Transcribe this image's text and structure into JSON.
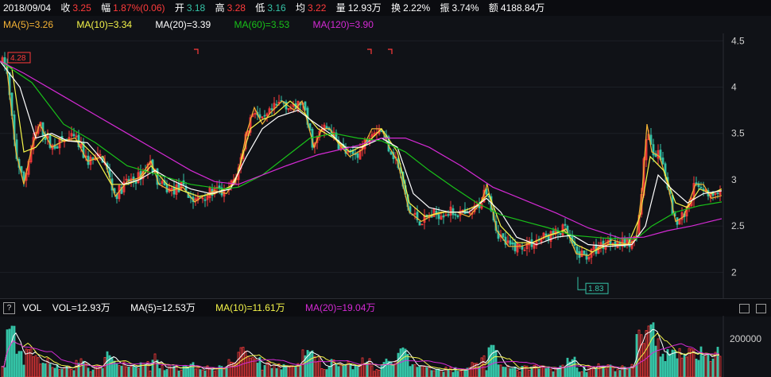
{
  "header": {
    "date": "2018/09/04",
    "close_label": "收",
    "close_value": "3.25",
    "change_label": "幅",
    "change_value": "1.87%(0.06)",
    "open_label": "开",
    "open_value": "3.18",
    "high_label": "高",
    "high_value": "3.28",
    "low_label": "低",
    "low_value": "3.16",
    "avg_label": "均",
    "avg_value": "3.22",
    "volume_label": "量",
    "volume_value": "12.93万",
    "turnover_label": "换",
    "turnover_value": "2.22%",
    "amplitude_label": "振",
    "amplitude_value": "3.74%",
    "amount_label": "额",
    "amount_value": "4188.84万"
  },
  "ma_legend": [
    {
      "text": "MA(5)=3.26",
      "color": "#f5b335"
    },
    {
      "text": "MA(10)=3.34",
      "color": "#f5f54a"
    },
    {
      "text": "MA(20)=3.39",
      "color": "#ffffff"
    },
    {
      "text": "MA(60)=3.53",
      "color": "#19c119"
    },
    {
      "text": "MA(120)=3.90",
      "color": "#d52ad5"
    }
  ],
  "volume_header": {
    "help_icon": "question-icon",
    "title": "VOL",
    "vol": "VOL=12.93万",
    "ma5": "MA(5)=12.53万",
    "ma10": "MA(10)=11.61万",
    "ma20": "MA(20)=19.04万"
  },
  "colors": {
    "up": "#ff3b3b",
    "down": "#35c3a7",
    "ma5": "#f5b335",
    "ma10": "#f5f54a",
    "ma20": "#ffffff",
    "ma60": "#19c119",
    "ma120": "#d52ad5",
    "background": "#101217"
  },
  "chart_data": {
    "type": "line",
    "description": "Daily candlestick chart with moving averages and volume sub-chart",
    "y_ticks": [
      "4.5",
      "4",
      "3.5",
      "3",
      "2.5",
      "2"
    ],
    "ylim": [
      1.72,
      4.58
    ],
    "high_marker": "4.28",
    "low_marker": "1.83",
    "volume_tick": "200000",
    "volume_ylim": [
      0,
      320000
    ],
    "series": [
      {
        "name": "MA(5)",
        "color": "#f5b335",
        "points": [
          [
            0,
            4.28
          ],
          [
            8,
            4.25
          ],
          [
            20,
            3.3
          ],
          [
            30,
            2.95
          ],
          [
            40,
            3.35
          ],
          [
            50,
            3.6
          ],
          [
            65,
            3.35
          ],
          [
            80,
            3.42
          ],
          [
            95,
            3.45
          ],
          [
            110,
            3.2
          ],
          [
            130,
            3.25
          ],
          [
            145,
            2.82
          ],
          [
            160,
            2.98
          ],
          [
            175,
            3.02
          ],
          [
            190,
            3.2
          ],
          [
            200,
            2.95
          ],
          [
            215,
            2.88
          ],
          [
            230,
            2.92
          ],
          [
            245,
            2.76
          ],
          [
            255,
            2.82
          ],
          [
            270,
            2.88
          ],
          [
            285,
            2.85
          ],
          [
            300,
            3.08
          ],
          [
            310,
            3.5
          ],
          [
            320,
            3.78
          ],
          [
            330,
            3.6
          ],
          [
            340,
            3.72
          ],
          [
            355,
            3.85
          ],
          [
            370,
            3.75
          ],
          [
            380,
            3.85
          ],
          [
            395,
            3.35
          ],
          [
            405,
            3.55
          ],
          [
            415,
            3.55
          ],
          [
            425,
            3.4
          ],
          [
            440,
            3.25
          ],
          [
            455,
            3.32
          ],
          [
            468,
            3.55
          ],
          [
            480,
            3.55
          ],
          [
            490,
            3.35
          ],
          [
            500,
            3.2
          ],
          [
            515,
            2.65
          ],
          [
            530,
            2.55
          ],
          [
            545,
            2.62
          ],
          [
            560,
            2.65
          ],
          [
            575,
            2.65
          ],
          [
            590,
            2.6
          ],
          [
            605,
            2.75
          ],
          [
            613,
            2.95
          ],
          [
            625,
            2.45
          ],
          [
            640,
            2.28
          ],
          [
            655,
            2.28
          ],
          [
            670,
            2.32
          ],
          [
            685,
            2.38
          ],
          [
            700,
            2.42
          ],
          [
            712,
            2.47
          ],
          [
            725,
            2.2
          ],
          [
            740,
            2.18
          ],
          [
            755,
            2.28
          ],
          [
            770,
            2.35
          ],
          [
            790,
            2.3
          ],
          [
            800,
            2.35
          ],
          [
            808,
            2.9
          ],
          [
            814,
            3.6
          ],
          [
            820,
            3.3
          ],
          [
            830,
            3.25
          ],
          [
            840,
            2.95
          ],
          [
            850,
            2.55
          ],
          [
            860,
            2.6
          ],
          [
            875,
            2.95
          ],
          [
            885,
            2.95
          ],
          [
            895,
            2.8
          ],
          [
            908,
            2.83
          ]
        ]
      },
      {
        "name": "MA(10)",
        "color": "#f5f54a",
        "points": [
          [
            0,
            4.28
          ],
          [
            15,
            4.2
          ],
          [
            30,
            3.3
          ],
          [
            45,
            3.35
          ],
          [
            60,
            3.5
          ],
          [
            80,
            3.42
          ],
          [
            100,
            3.42
          ],
          [
            120,
            3.25
          ],
          [
            140,
            2.95
          ],
          [
            160,
            2.95
          ],
          [
            175,
            3.0
          ],
          [
            190,
            3.15
          ],
          [
            210,
            2.95
          ],
          [
            230,
            2.88
          ],
          [
            250,
            2.82
          ],
          [
            270,
            2.85
          ],
          [
            295,
            2.95
          ],
          [
            315,
            3.55
          ],
          [
            330,
            3.65
          ],
          [
            345,
            3.7
          ],
          [
            365,
            3.85
          ],
          [
            385,
            3.7
          ],
          [
            400,
            3.55
          ],
          [
            420,
            3.45
          ],
          [
            440,
            3.3
          ],
          [
            460,
            3.38
          ],
          [
            480,
            3.55
          ],
          [
            500,
            3.3
          ],
          [
            515,
            2.75
          ],
          [
            535,
            2.6
          ],
          [
            555,
            2.65
          ],
          [
            580,
            2.65
          ],
          [
            600,
            2.72
          ],
          [
            615,
            2.85
          ],
          [
            630,
            2.5
          ],
          [
            650,
            2.32
          ],
          [
            670,
            2.32
          ],
          [
            690,
            2.4
          ],
          [
            710,
            2.45
          ],
          [
            725,
            2.3
          ],
          [
            745,
            2.22
          ],
          [
            765,
            2.3
          ],
          [
            790,
            2.3
          ],
          [
            805,
            2.6
          ],
          [
            818,
            3.25
          ],
          [
            835,
            3.1
          ],
          [
            850,
            2.75
          ],
          [
            865,
            2.7
          ],
          [
            880,
            2.9
          ],
          [
            895,
            2.85
          ],
          [
            908,
            2.9
          ]
        ]
      },
      {
        "name": "MA(20)",
        "color": "#ffffff",
        "points": [
          [
            0,
            4.28
          ],
          [
            25,
            4.0
          ],
          [
            45,
            3.45
          ],
          [
            65,
            3.5
          ],
          [
            85,
            3.42
          ],
          [
            110,
            3.4
          ],
          [
            135,
            3.15
          ],
          [
            155,
            2.95
          ],
          [
            175,
            3.0
          ],
          [
            195,
            3.1
          ],
          [
            215,
            3.0
          ],
          [
            240,
            2.9
          ],
          [
            265,
            2.85
          ],
          [
            290,
            2.9
          ],
          [
            310,
            3.25
          ],
          [
            330,
            3.55
          ],
          [
            350,
            3.68
          ],
          [
            375,
            3.75
          ],
          [
            395,
            3.62
          ],
          [
            415,
            3.5
          ],
          [
            435,
            3.35
          ],
          [
            455,
            3.35
          ],
          [
            480,
            3.45
          ],
          [
            500,
            3.35
          ],
          [
            520,
            2.85
          ],
          [
            540,
            2.7
          ],
          [
            565,
            2.65
          ],
          [
            590,
            2.65
          ],
          [
            612,
            2.8
          ],
          [
            630,
            2.65
          ],
          [
            650,
            2.38
          ],
          [
            675,
            2.3
          ],
          [
            700,
            2.38
          ],
          [
            720,
            2.4
          ],
          [
            740,
            2.3
          ],
          [
            765,
            2.28
          ],
          [
            795,
            2.3
          ],
          [
            812,
            2.5
          ],
          [
            828,
            3.05
          ],
          [
            845,
            2.9
          ],
          [
            865,
            2.75
          ],
          [
            885,
            2.85
          ],
          [
            908,
            2.88
          ]
        ]
      },
      {
        "name": "MA(60)",
        "color": "#19c119",
        "points": [
          [
            0,
            4.28
          ],
          [
            40,
            4.05
          ],
          [
            80,
            3.6
          ],
          [
            120,
            3.4
          ],
          [
            160,
            3.15
          ],
          [
            200,
            3.05
          ],
          [
            240,
            2.95
          ],
          [
            280,
            2.9
          ],
          [
            300,
            2.92
          ],
          [
            330,
            3.05
          ],
          [
            360,
            3.25
          ],
          [
            390,
            3.45
          ],
          [
            420,
            3.5
          ],
          [
            450,
            3.45
          ],
          [
            480,
            3.42
          ],
          [
            510,
            3.3
          ],
          [
            540,
            3.1
          ],
          [
            570,
            2.92
          ],
          [
            600,
            2.75
          ],
          [
            630,
            2.62
          ],
          [
            660,
            2.55
          ],
          [
            690,
            2.48
          ],
          [
            720,
            2.4
          ],
          [
            760,
            2.37
          ],
          [
            800,
            2.36
          ],
          [
            820,
            2.5
          ],
          [
            850,
            2.65
          ],
          [
            880,
            2.72
          ],
          [
            908,
            2.76
          ]
        ]
      },
      {
        "name": "MA(120)",
        "color": "#d52ad5",
        "points": [
          [
            0,
            4.28
          ],
          [
            30,
            4.15
          ],
          [
            80,
            3.9
          ],
          [
            120,
            3.7
          ],
          [
            160,
            3.5
          ],
          [
            200,
            3.3
          ],
          [
            240,
            3.1
          ],
          [
            270,
            2.98
          ],
          [
            300,
            2.95
          ],
          [
            330,
            3.05
          ],
          [
            360,
            3.15
          ],
          [
            400,
            3.27
          ],
          [
            450,
            3.37
          ],
          [
            480,
            3.45
          ],
          [
            510,
            3.45
          ],
          [
            540,
            3.35
          ],
          [
            580,
            3.15
          ],
          [
            620,
            2.92
          ],
          [
            660,
            2.78
          ],
          [
            700,
            2.64
          ],
          [
            740,
            2.48
          ],
          [
            780,
            2.37
          ],
          [
            810,
            2.38
          ],
          [
            840,
            2.45
          ],
          [
            870,
            2.5
          ],
          [
            908,
            2.58
          ]
        ]
      }
    ]
  }
}
